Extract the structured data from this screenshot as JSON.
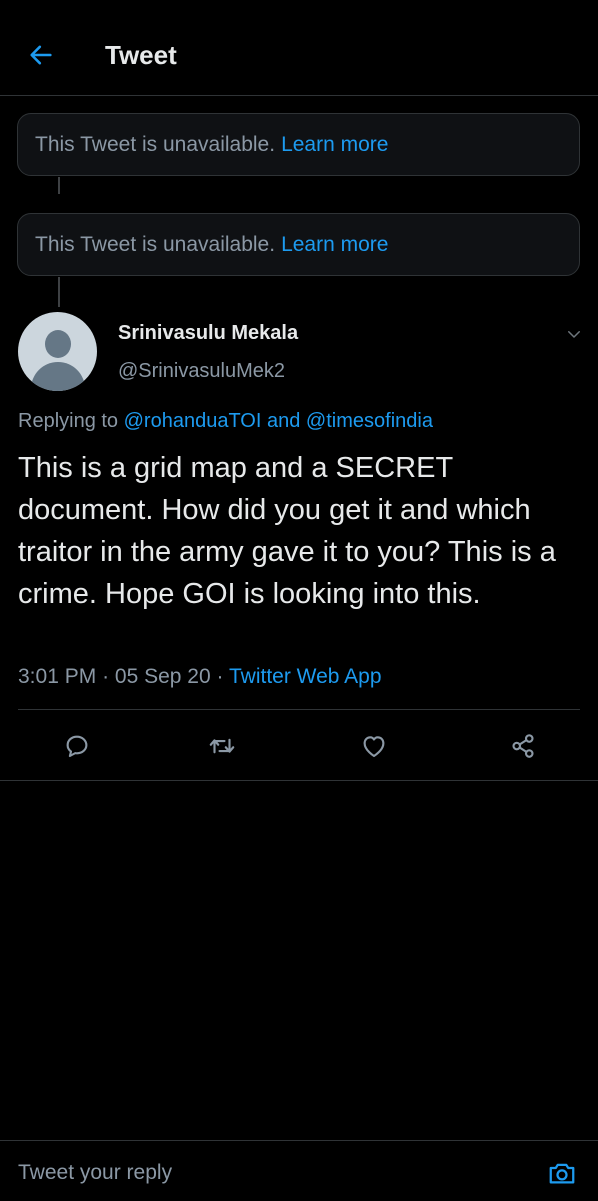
{
  "header": {
    "back_icon": "arrow-left-icon",
    "title": "Tweet"
  },
  "unavailable_tweets": [
    {
      "text": "This Tweet is unavailable.",
      "link": "Learn more"
    },
    {
      "text": "This Tweet is unavailable.",
      "link": "Learn more"
    }
  ],
  "tweet": {
    "display_name": "Srinivasulu Mekala",
    "handle": "@SrinivasuluMek2",
    "replying_prefix": "Replying to",
    "mention_1": "@rohanduaTOI",
    "replying_and": "and",
    "mention_2": "@timesofindia",
    "text": "This is a grid map and a SECRET document. How did you get it and which traitor in the army gave it to you? This is a crime. Hope GOI is looking into this.",
    "time": "3:01 PM",
    "dot": "·",
    "date": "05 Sep 20",
    "source": "Twitter Web App"
  },
  "actions": [
    "reply-icon",
    "retweet-icon",
    "like-icon",
    "share-icon"
  ],
  "composer": {
    "placeholder": "Tweet your reply",
    "camera_icon": "camera-icon"
  },
  "colors": {
    "background": "#000000",
    "accent": "#1d9bf0",
    "muted": "#8b98a5",
    "border": "#2f3336"
  }
}
